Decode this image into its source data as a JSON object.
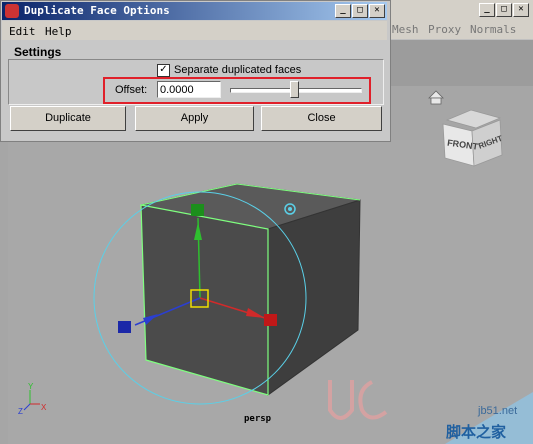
{
  "dialog": {
    "title": "Duplicate Face Options",
    "menu": [
      "Edit",
      "Help"
    ],
    "section_title": "Settings",
    "checkbox_label": "Separate duplicated faces",
    "checkbox_checked": true,
    "offset_label": "Offset:",
    "offset_value": "0.0000",
    "buttons": {
      "duplicate": "Duplicate",
      "apply": "Apply",
      "close": "Close"
    },
    "window_controls": {
      "minimize": "_",
      "maximize": "□",
      "close": "✕"
    }
  },
  "background_window": {
    "menu": [
      "Mesh",
      "Proxy",
      "Normals"
    ],
    "window_controls": {
      "minimize": "_",
      "maximize": "□",
      "close": "✕"
    }
  },
  "viewport": {
    "camera_label": "persp",
    "viewcube_front": "FRONT",
    "viewcube_right": "RIGHT",
    "axis_labels": {
      "x": "X",
      "y": "Y",
      "z": "Z"
    }
  },
  "watermark": {
    "site": "jb51.net",
    "name_cn": "脚本之家"
  },
  "colors": {
    "highlight_box": "#e0202a",
    "title_gradient_start": "#0a246a",
    "title_gradient_end": "#a6caf0",
    "selection_edge": "#7fff7f",
    "manip_circle": "#5ad0e8"
  }
}
